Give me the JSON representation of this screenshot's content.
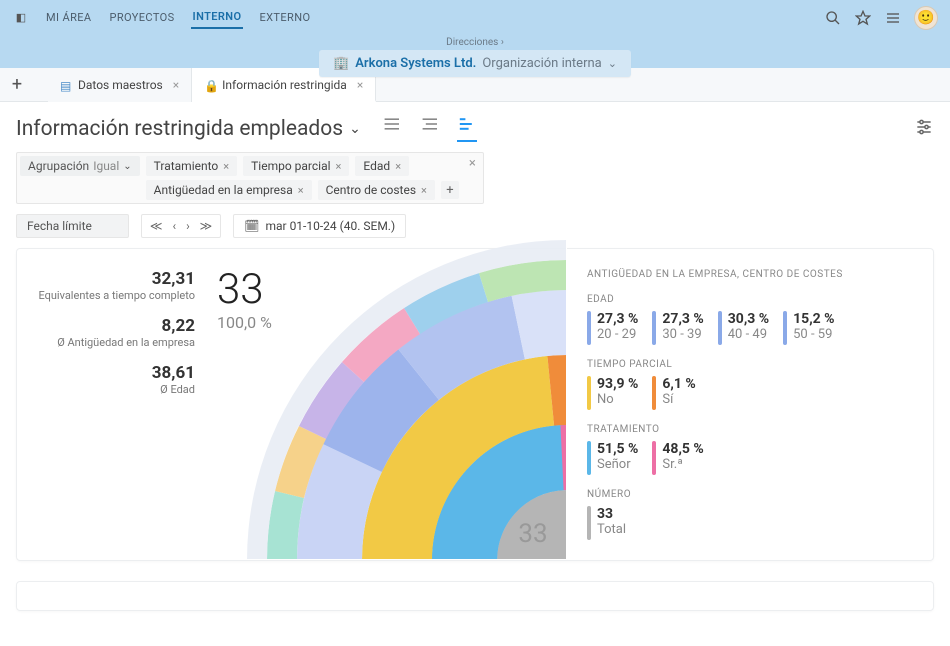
{
  "topnav": {
    "items": [
      "MI ÁREA",
      "PROYECTOS",
      "INTERNO",
      "EXTERNO"
    ],
    "active": 2
  },
  "breadcrumb": {
    "path": "Direcciones  ›",
    "org_name": "Arkona Systems Ltd.",
    "org_sub": "Organización interna"
  },
  "tabs": [
    {
      "label": "Datos maestros",
      "active": false
    },
    {
      "label": "Información restringida",
      "active": true
    }
  ],
  "page": {
    "title": "Información restringida empleados"
  },
  "filters": {
    "group_label": "Agrupación",
    "group_op": "Igual",
    "pills_row1": [
      "Tratamiento",
      "Tiempo parcial",
      "Edad"
    ],
    "pills_row2": [
      "Antigüedad en la empresa",
      "Centro de costes"
    ]
  },
  "date": {
    "label": "Fecha límite",
    "value": "mar 01-10-24 (40. SEM.)"
  },
  "kpis": [
    {
      "value": "32,31",
      "label": "Equivalentes a tiempo completo"
    },
    {
      "value": "8,22",
      "label": "Ø Antigüedad en la empresa"
    },
    {
      "value": "38,61",
      "label": "Ø Edad"
    }
  ],
  "chart": {
    "big_number": "33",
    "big_percent": "100,0 %",
    "center_label": "33"
  },
  "stats": {
    "header": "ANTIGÜEDAD EN LA EMPRESA, CENTRO DE COSTES",
    "groups": [
      {
        "title": "EDAD",
        "items": [
          {
            "pct": "27,3 %",
            "label": "20 - 29",
            "color": "#8aa9e8"
          },
          {
            "pct": "27,3 %",
            "label": "30 - 39",
            "color": "#8aa9e8"
          },
          {
            "pct": "30,3 %",
            "label": "40 - 49",
            "color": "#8aa9e8"
          },
          {
            "pct": "15,2 %",
            "label": "50 - 59",
            "color": "#8aa9e8"
          }
        ]
      },
      {
        "title": "TIEMPO PARCIAL",
        "items": [
          {
            "pct": "93,9 %",
            "label": "No",
            "color": "#f2c945"
          },
          {
            "pct": "6,1 %",
            "label": "Sí",
            "color": "#f08c3a"
          }
        ]
      },
      {
        "title": "TRATAMIENTO",
        "items": [
          {
            "pct": "51,5 %",
            "label": "Señor",
            "color": "#5bb7e8"
          },
          {
            "pct": "48,5 %",
            "label": "Sr.ª",
            "color": "#ed6fa5"
          }
        ]
      },
      {
        "title": "NÚMERO",
        "items": [
          {
            "pct": "33",
            "label": "Total",
            "color": "#b5b5b5"
          }
        ]
      }
    ]
  },
  "chart_data": {
    "type": "pie",
    "title": "Información restringida empleados",
    "total": 33,
    "rings": [
      {
        "name": "Tratamiento",
        "series": [
          {
            "name": "Señor",
            "value": 17,
            "pct": 51.5,
            "color": "#5bb7e8"
          },
          {
            "name": "Sr.ª",
            "value": 16,
            "pct": 48.5,
            "color": "#ed6fa5"
          }
        ]
      },
      {
        "name": "Tiempo parcial",
        "series": [
          {
            "name": "No",
            "value": 31,
            "pct": 93.9,
            "color": "#f2c945"
          },
          {
            "name": "Sí",
            "value": 2,
            "pct": 6.1,
            "color": "#f08c3a"
          }
        ]
      },
      {
        "name": "Edad",
        "series": [
          {
            "name": "20 - 29",
            "value": 9,
            "pct": 27.3,
            "color": "#9db4ec"
          },
          {
            "name": "30 - 39",
            "value": 9,
            "pct": 27.3,
            "color": "#b2c3f0"
          },
          {
            "name": "40 - 49",
            "value": 10,
            "pct": 30.3,
            "color": "#8aa9e8"
          },
          {
            "name": "50 - 59",
            "value": 5,
            "pct": 15.2,
            "color": "#c9d4f5"
          }
        ]
      }
    ]
  }
}
